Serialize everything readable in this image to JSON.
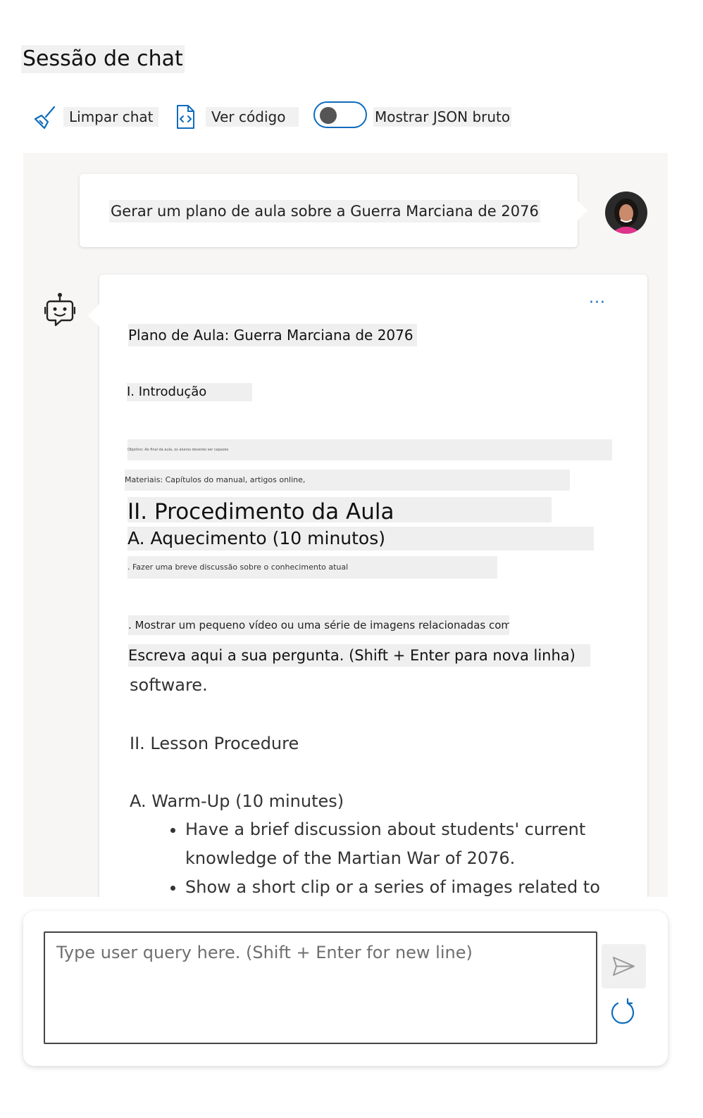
{
  "page": {
    "title": "Sessão de chat"
  },
  "toolbar": {
    "clear_label": "Limpar chat",
    "view_code_label": "Ver código",
    "raw_json_label": "Mostrar JSON bruto",
    "raw_json_on": false
  },
  "user_message": {
    "text": "Gerar um plano de aula sobre a Guerra Marciana de 2076"
  },
  "bot_message": {
    "more_label": "...",
    "lines": {
      "title": "Plano de Aula: Guerra Marciana de 2076",
      "intro": "I. Introdução",
      "objective": "Objetivo: Ao final da aula, os alunos deverão ser capazes",
      "materials": "Materiais: Capítulos do manual, artigos online,",
      "procedure_h": "II. Procedimento da Aula",
      "warmup_h": "A. Aquecimento (10 minutos)",
      "warmup_1": ". Fazer uma breve discussão sobre o conhecimento atual",
      "warmup_2": ". Mostrar um pequeno vídeo ou uma série de imagens relacionadas com",
      "overlay_placeholder": "Escreva aqui a sua pergunta. (Shift + Enter para nova linha)",
      "software": "software.",
      "lesson_procedure": "II. Lesson Procedure",
      "warm_up": "A. Warm-Up (10 minutes)"
    },
    "bullets": [
      "Have a brief discussion about students' current knowledge of the Martian War of 2076.",
      "Show a short clip or a series of images related to"
    ]
  },
  "composer": {
    "placeholder": "Type user query here. (Shift + Enter for new line)"
  },
  "colors": {
    "accent": "#0f6cbd",
    "pane_bg": "#f7f6f5",
    "highlight": "#efefef"
  }
}
